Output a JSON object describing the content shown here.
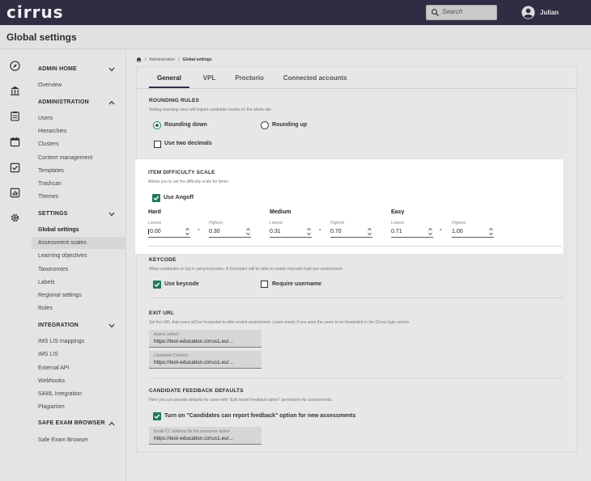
{
  "app": {
    "logo": "cirrus",
    "search_placeholder": "Search",
    "user_name": "Julian"
  },
  "header": {
    "title": "Global settings"
  },
  "breadcrumb": {
    "items": [
      "Administration",
      "/",
      "Global settings"
    ],
    "sep": "/"
  },
  "tabs": [
    {
      "label": "General",
      "active": true
    },
    {
      "label": "VPL",
      "active": false
    },
    {
      "label": "Proctorio",
      "active": false
    },
    {
      "label": "Connected accounts",
      "active": false
    }
  ],
  "sidebar": {
    "admin_home": {
      "label": "ADMIN HOME",
      "items": [
        "Overview"
      ]
    },
    "administration": {
      "label": "ADMINISTRATION",
      "items": [
        "Users",
        "Hierarchies",
        "Clusters",
        "Content management",
        "Templates",
        "Trashcan",
        "Themes"
      ]
    },
    "settings": {
      "label": "SETTINGS",
      "items": [
        "Global settings",
        "Assessment scales",
        "Learning objectives",
        "Taxonomies",
        "Labels",
        "Regional settings",
        "Roles"
      ]
    },
    "integration": {
      "label": "INTEGRATION",
      "items": [
        "IMS LIS mappings",
        "IMS LIS",
        "External API",
        "Webhooks",
        "SAML Integration",
        "Plagiarism"
      ]
    },
    "safe_exam": {
      "label": "SAFE EXAM BROWSER",
      "items": [
        "Safe Exam Browser"
      ]
    }
  },
  "rounding": {
    "title": "ROUNDING RULES",
    "subtitle": "Setting rounding rules will impact candidate results on the whole site",
    "option_down": "Rounding down",
    "option_up": "Rounding up",
    "two_decimals": "Use two decimals"
  },
  "difficulty": {
    "title": "ITEM DIFFICULTY SCALE",
    "subtitle": "Allows you to set the difficulty scale for items.",
    "use_angoff": "Use Angoff",
    "lowest_label": "Lowest",
    "highest_label": "Highest",
    "dash": "-",
    "groups": [
      {
        "name": "Hard",
        "lowest": "0.00",
        "highest": "0.30"
      },
      {
        "name": "Medium",
        "lowest": "0.31",
        "highest": "0.70"
      },
      {
        "name": "Easy",
        "lowest": "0.71",
        "highest": "1.00"
      }
    ]
  },
  "keycode": {
    "title": "KEYCODE",
    "subtitle": "Allow candidates to log in using keycodes. A Scheduler will be able to enable keycode login per assessment.",
    "use_keycode": "Use keycode",
    "require_username": "Require username"
  },
  "exit_url": {
    "title": "EXIT URL",
    "subtitle": "Set the URL that users will be forwarded to after ended assessment. Leave empty if you want the users to be forwarded to the Cirrus login screen",
    "author_label": "Author (other)",
    "author_value": "https://test-education.cirrus1.eu/...",
    "candidate_label": "Candidate Delivery",
    "candidate_value": "https://test-education.cirrus1.eu/..."
  },
  "feedback": {
    "title": "CANDIDATE FEEDBACK DEFAULTS",
    "subtitle": "Here you can provide defaults for users with \"Edit report feedback option\" permission for assessments.",
    "option": "Turn on \"Candidates can report feedback\" option for new assessments",
    "email_label": "Email CC address for the announce action",
    "email_value": "https://test-education.cirrus1.eu/..."
  },
  "colors": {
    "topbar": "#2f2c44",
    "accent_green": "#1e7a57"
  }
}
